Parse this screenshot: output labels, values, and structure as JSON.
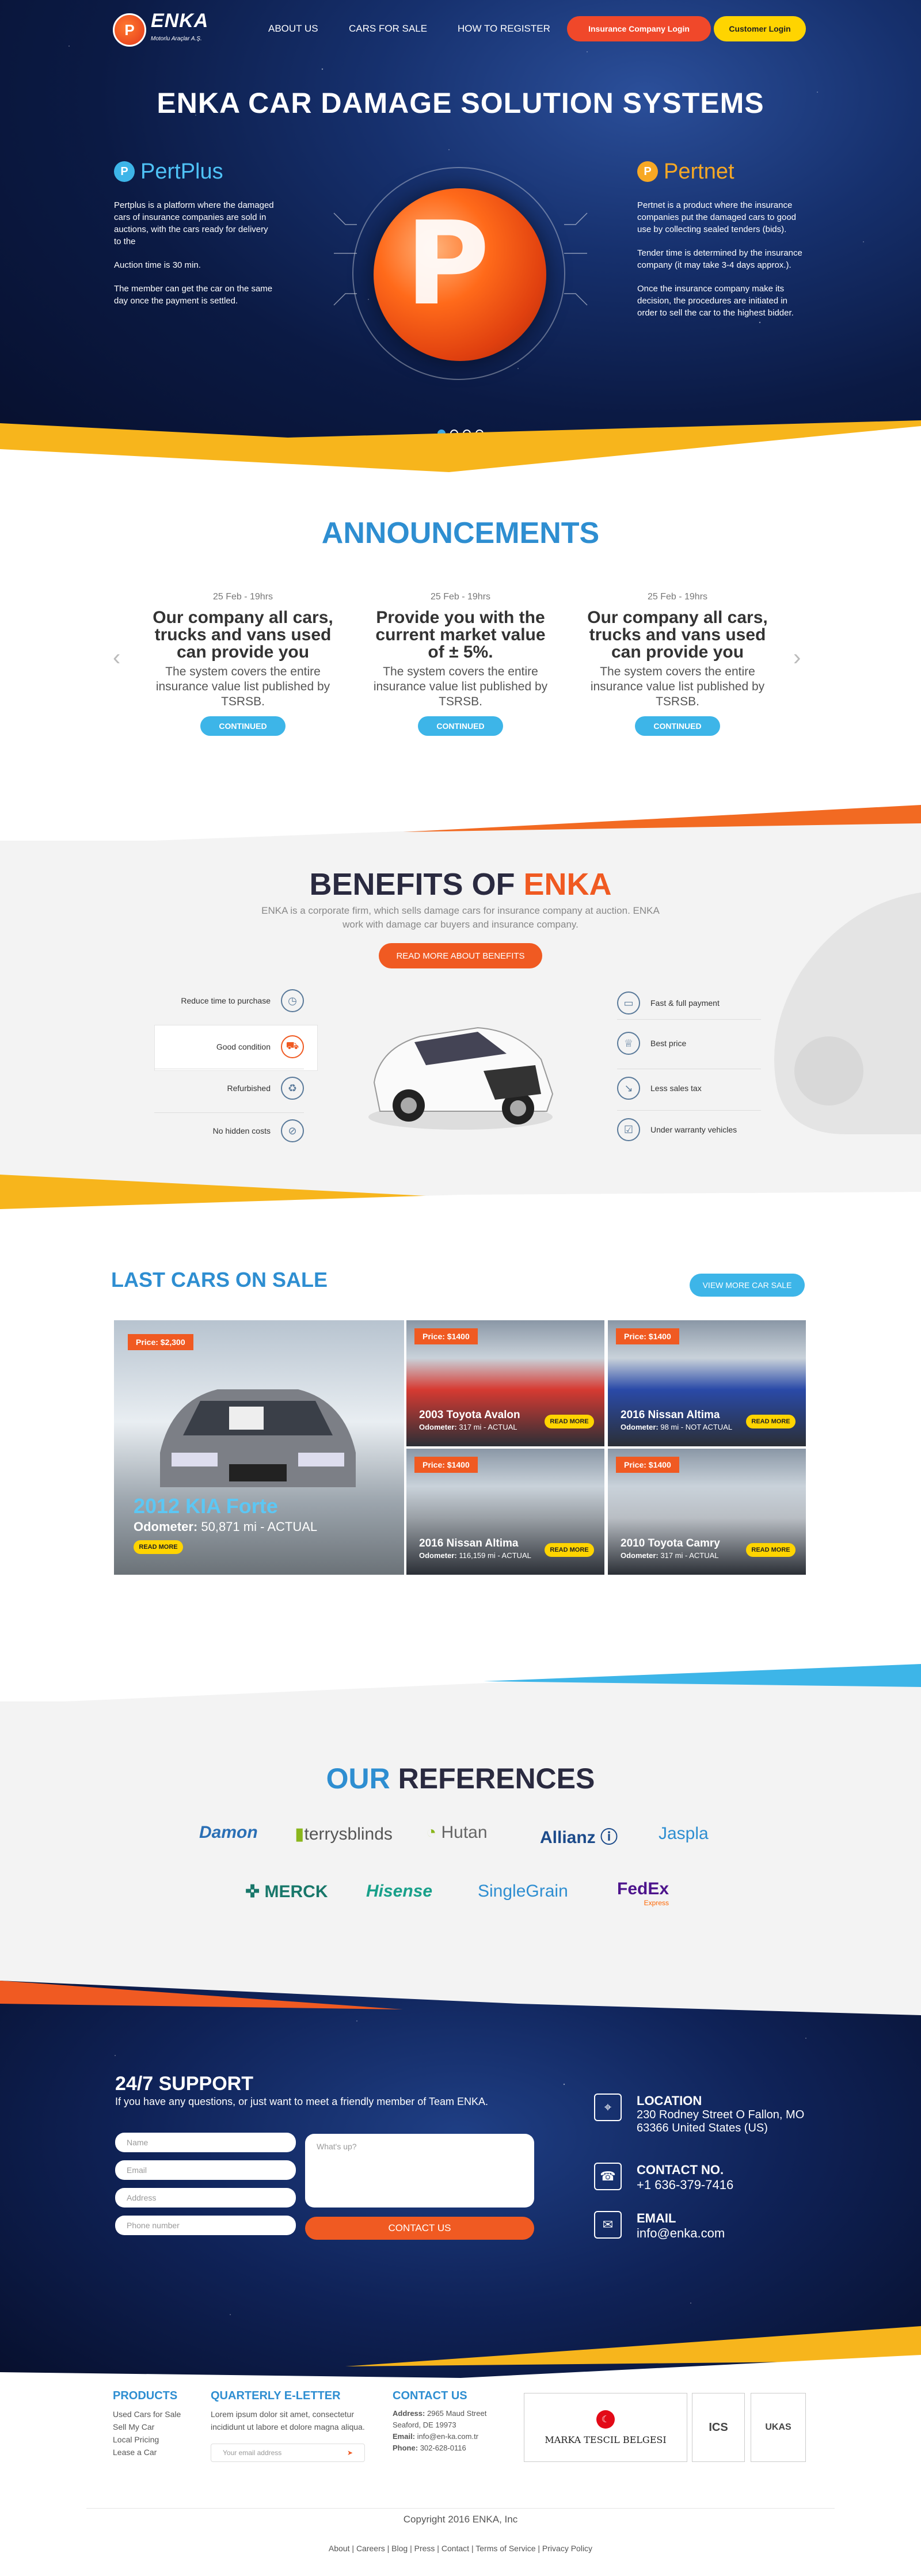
{
  "brand": {
    "name": "ENKA",
    "tagline": "Motorlu Araçlar A.Ş."
  },
  "nav": {
    "items": [
      "ABOUT US",
      "CARS FOR SALE",
      "HOW TO REGISTER"
    ],
    "insurance_login": "Insurance Company Login",
    "customer_login": "Customer Login"
  },
  "hero": {
    "title": "ENKA CAR DAMAGE SOLUTION SYSTEMS",
    "left": {
      "name": "PertPlus",
      "p1": "Pertplus is a platform where the damaged cars of insurance companies are sold in auctions, with the cars ready for delivery to the",
      "p2": "Auction time is 30 min.",
      "p3": "The member can get the car on the same day once the payment is settled."
    },
    "right": {
      "name": "Pertnet",
      "p1": "Pertnet is a product where the insurance companies put the damaged cars to good use by collecting sealed tenders (bids).",
      "p2": "Tender time is determined by the insurance company (it may take 3-4 days approx.).",
      "p3": "Once the insurance company make its decision, the procedures are initiated in order to sell the car to the highest bidder."
    }
  },
  "announcements": {
    "title": "ANNOUNCEMENTS",
    "items": [
      {
        "date": "25 Feb - 19hrs",
        "heading": "Our company all cars, trucks and vans used can provide you",
        "text": "The system covers the entire insurance value list published by TSRSB.",
        "button": "CONTINUED"
      },
      {
        "date": "25 Feb - 19hrs",
        "heading": "Provide you with the current market value of ± 5%.",
        "text": "The system covers the entire insurance value list published by TSRSB.",
        "button": "CONTINUED"
      },
      {
        "date": "25 Feb - 19hrs",
        "heading": "Our company all cars, trucks and vans used can provide you",
        "text": "The system covers the entire insurance value list published by TSRSB.",
        "button": "CONTINUED"
      }
    ]
  },
  "benefits": {
    "title_a": "BENEFITS OF",
    "title_b": "ENKA",
    "text": "ENKA is a corporate firm, which sells damage cars for insurance company at auction. ENKA work with damage car buyers and insurance company.",
    "button": "READ MORE ABOUT BENEFITS",
    "left": [
      "Reduce time to purchase",
      "Good condition",
      "Refurbished",
      "No hidden costs"
    ],
    "right": [
      "Fast & full payment",
      "Best price",
      "Less sales tax",
      "Under warranty vehicles"
    ]
  },
  "cars": {
    "title": "LAST CARS ON SALE",
    "view_more": "VIEW MORE CAR SALE",
    "featured": {
      "price": "Price: $2,300",
      "title": "2012 KIA Forte",
      "odo_label": "Odometer:",
      "odo": "50,871 mi - ACTUAL",
      "button": "READ MORE"
    },
    "items": [
      {
        "price": "Price: $1400",
        "title": "2003 Toyota Avalon",
        "odo_label": "Odometer:",
        "odo": "317 mi - ACTUAL",
        "button": "READ MORE",
        "color": "#d63a32"
      },
      {
        "price": "Price: $1400",
        "title": "2016 Nissan Altima",
        "odo_label": "Odometer:",
        "odo": "98 mi - NOT ACTUAL",
        "button": "READ MORE",
        "color": "#2a4aa8"
      },
      {
        "price": "Price: $1400",
        "title": "2016 Nissan Altima",
        "odo_label": "Odometer:",
        "odo": "116,159 mi - ACTUAL",
        "button": "READ MORE",
        "color": "#9aa0a6"
      },
      {
        "price": "Price: $1400",
        "title": "2010 Toyota Camry",
        "odo_label": "Odometer:",
        "odo": "317 mi - ACTUAL",
        "button": "READ MORE",
        "color": "#b9bec4"
      }
    ]
  },
  "references": {
    "title_a": "OUR",
    "title_b": "REFERENCES",
    "logos": [
      "Damon",
      "terrysblinds",
      "Hutan",
      "Allianz",
      "Jaspla",
      "MERCK",
      "Hisense",
      "SingleGrain",
      "FedEx"
    ],
    "fedex_sub": "Express"
  },
  "support": {
    "title": "24/7 SUPPORT",
    "subtitle": "If you have any questions, or just want to meet a friendly member of Team ENKA.",
    "ph_name": "Name",
    "ph_email": "Email",
    "ph_address": "Address",
    "ph_phone": "Phone number",
    "ph_msg": "What's up?",
    "button": "CONTACT US",
    "location_label": "LOCATION",
    "location": "230 Rodney Street O Fallon, MO 63366 United States (US)",
    "contact_label": "CONTACT NO.",
    "contact": "+1 636-379-7416",
    "email_label": "EMAIL",
    "email": "info@enka.com"
  },
  "footer": {
    "products_title": "PRODUCTS",
    "products": [
      "Used Cars for Sale",
      "Sell My Car",
      "Local Pricing",
      "Lease a Car"
    ],
    "letter_title": "QUARTERLY E-LETTER",
    "letter_text": "Lorem ipsum dolor sit amet, consectetur incididunt ut labore et dolore magna aliqua.",
    "letter_ph": "Your email address",
    "contact_title": "CONTACT US",
    "address_label": "Address:",
    "address": "2965 Maud Street Seaford, DE 19973",
    "email_label": "Email:",
    "email": "info@en-ka.com.tr",
    "phone_label": "Phone:",
    "phone": "302-628-0116",
    "cert1": "MARKA TESCIL BELGESI",
    "cert2": "ICS",
    "cert3": "UKAS",
    "copyright": "Copyright  2016 ENKA, Inc",
    "links": [
      "About",
      "Careers",
      "Blog",
      "Press",
      "Contact",
      "Terms of Service",
      "Privacy Policy"
    ]
  },
  "colors": {
    "orange": "#f05a22",
    "blue": "#2e8ed1",
    "yellow": "#ffd400",
    "light_blue": "#3db5e8"
  }
}
